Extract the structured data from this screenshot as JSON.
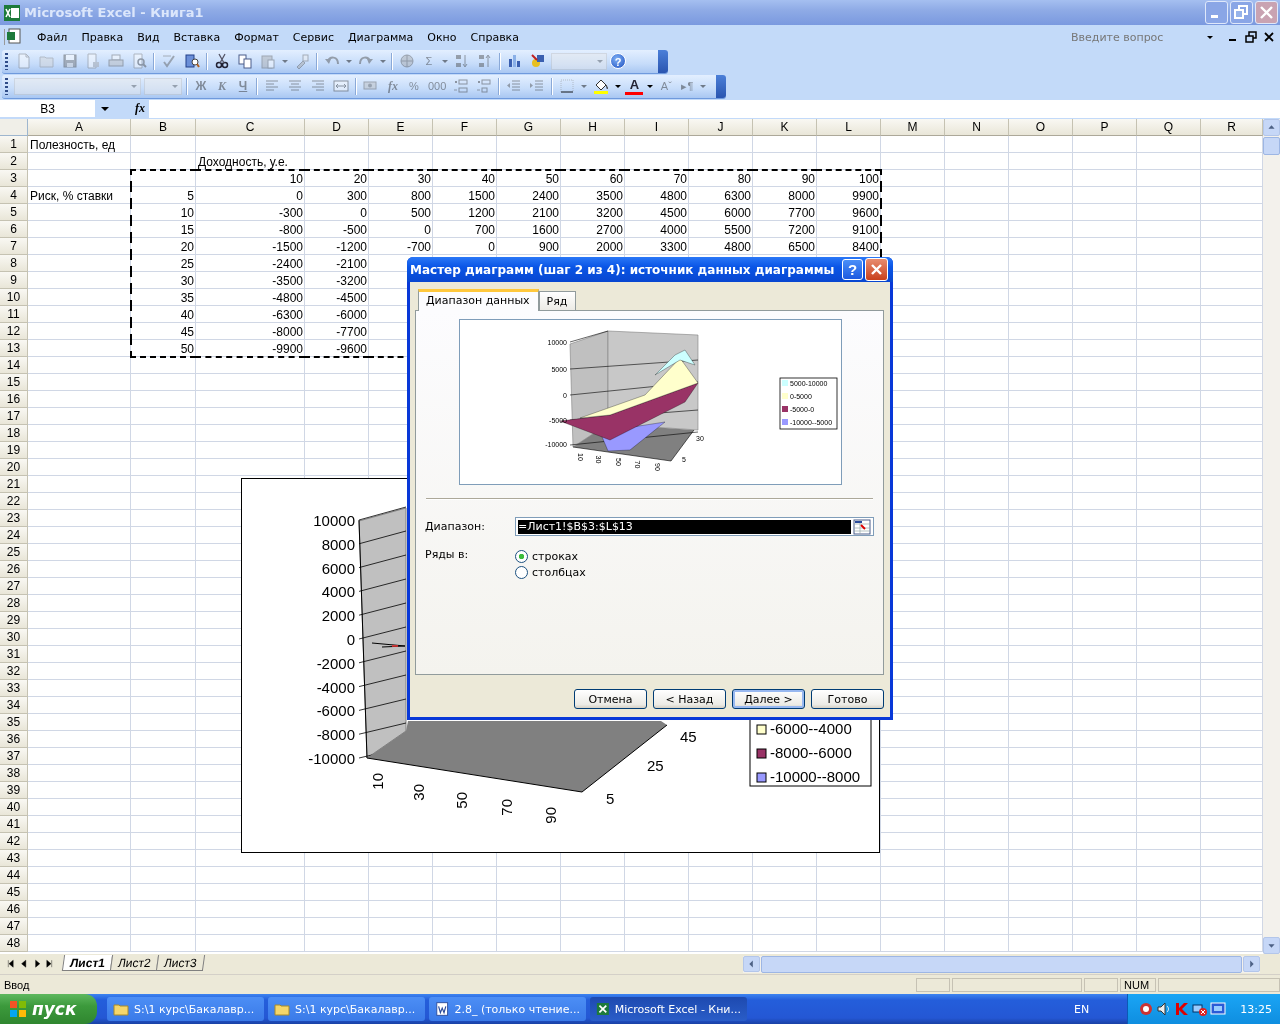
{
  "window": {
    "title": "Microsoft Excel - Книга1"
  },
  "menu": [
    "Файл",
    "Правка",
    "Вид",
    "Вставка",
    "Формат",
    "Сервис",
    "Диаграмма",
    "Окно",
    "Справка"
  ],
  "help_box": {
    "placeholder": "Введите вопрос"
  },
  "toolbar_standard": [
    {
      "kind": "new",
      "disabled": true
    },
    {
      "kind": "open",
      "disabled": true
    },
    {
      "kind": "save",
      "disabled": true
    },
    {
      "kind": "permission",
      "disabled": true
    },
    {
      "kind": "print",
      "disabled": true
    },
    {
      "kind": "preview",
      "disabled": true
    },
    {
      "kind": "sep",
      "disabled": false
    },
    {
      "kind": "spell",
      "disabled": true
    },
    {
      "kind": "research",
      "disabled": false
    },
    {
      "kind": "sep",
      "disabled": false
    },
    {
      "kind": "cut",
      "disabled": false
    },
    {
      "kind": "copy",
      "disabled": false
    },
    {
      "kind": "paste",
      "disabled": true
    },
    {
      "kind": "caret",
      "disabled": true
    },
    {
      "kind": "brush",
      "disabled": true
    },
    {
      "kind": "sep",
      "disabled": false
    },
    {
      "kind": "undo",
      "disabled": true
    },
    {
      "kind": "caret",
      "disabled": true
    },
    {
      "kind": "redo",
      "disabled": true
    },
    {
      "kind": "caret",
      "disabled": true
    },
    {
      "kind": "sep",
      "disabled": false
    },
    {
      "kind": "hyperlink",
      "disabled": true
    },
    {
      "kind": "text",
      "label": "Σ",
      "disabled": true
    },
    {
      "kind": "caret",
      "disabled": true
    },
    {
      "kind": "sortasc",
      "disabled": true
    },
    {
      "kind": "sortdesc",
      "disabled": true
    },
    {
      "kind": "sep",
      "disabled": false
    },
    {
      "kind": "chart",
      "disabled": false
    },
    {
      "kind": "drawing",
      "disabled": false
    },
    {
      "kind": "combo",
      "disabled": true
    },
    {
      "kind": "help",
      "label": "?",
      "disabled": false
    }
  ],
  "toolbar_formatting": [
    {
      "kind": "fontcombo",
      "disabled": true
    },
    {
      "kind": "sizecombo",
      "disabled": true
    },
    {
      "kind": "sep",
      "disabled": false
    },
    {
      "kind": "bold",
      "label": "Ж",
      "disabled": true
    },
    {
      "kind": "italic",
      "label": "К",
      "disabled": true
    },
    {
      "kind": "underline",
      "label": "Ч",
      "disabled": true
    },
    {
      "kind": "sep",
      "disabled": false
    },
    {
      "kind": "alignleft",
      "disabled": true
    },
    {
      "kind": "center",
      "disabled": true
    },
    {
      "kind": "alignright",
      "disabled": true
    },
    {
      "kind": "merge",
      "disabled": true
    },
    {
      "kind": "sep",
      "disabled": false
    },
    {
      "kind": "currency",
      "disabled": true
    },
    {
      "kind": "italic",
      "label": "fx",
      "disabled": true
    },
    {
      "kind": "text",
      "label": "%",
      "disabled": true
    },
    {
      "kind": "text",
      "label": "000",
      "disabled": true
    },
    {
      "kind": "incdec",
      "disabled": true
    },
    {
      "kind": "decdec",
      "disabled": true
    },
    {
      "kind": "sep",
      "disabled": false
    },
    {
      "kind": "outdent",
      "disabled": true
    },
    {
      "kind": "indent",
      "disabled": true
    },
    {
      "kind": "sep",
      "disabled": false
    },
    {
      "kind": "borders",
      "disabled": true
    },
    {
      "kind": "caret",
      "disabled": true
    },
    {
      "kind": "fill",
      "disabled": false
    },
    {
      "kind": "caret",
      "disabled": false
    },
    {
      "kind": "fontcolor",
      "label": "A",
      "disabled": false
    },
    {
      "kind": "caret",
      "disabled": false
    },
    {
      "kind": "text",
      "label": "Aˇ",
      "disabled": true
    },
    {
      "kind": "text",
      "label": "▸¶",
      "disabled": true
    },
    {
      "kind": "caret",
      "disabled": true
    }
  ],
  "name_box": {
    "value": "B3"
  },
  "formula_bar": {
    "fx": "fx"
  },
  "columns": [
    {
      "label": "A",
      "in_marquee": false
    },
    {
      "label": "B",
      "in_marquee": true
    },
    {
      "label": "C",
      "in_marquee": true
    },
    {
      "label": "D",
      "in_marquee": true
    },
    {
      "label": "E",
      "in_marquee": true
    },
    {
      "label": "F",
      "in_marquee": true
    },
    {
      "label": "G",
      "in_marquee": true
    },
    {
      "label": "H",
      "in_marquee": true
    },
    {
      "label": "I",
      "in_marquee": true
    },
    {
      "label": "J",
      "in_marquee": true
    },
    {
      "label": "K",
      "in_marquee": true
    },
    {
      "label": "L",
      "in_marquee": true
    },
    {
      "label": "M",
      "in_marquee": false
    },
    {
      "label": "N",
      "in_marquee": false
    },
    {
      "label": "O",
      "in_marquee": false
    },
    {
      "label": "P",
      "in_marquee": false
    },
    {
      "label": "Q",
      "in_marquee": false
    },
    {
      "label": "R",
      "in_marquee": false
    }
  ],
  "rows": [
    {
      "number": "1",
      "in_marquee": false,
      "cells": {
        "A": {
          "text": "Полезность, ед",
          "kind": "text"
        }
      }
    },
    {
      "number": "2",
      "in_marquee": false,
      "cells": {
        "C": {
          "text": "Доходность, у.е.",
          "kind": "text"
        }
      }
    },
    {
      "number": "3",
      "in_marquee": true,
      "cells": {
        "C": {
          "text": "10",
          "kind": "number"
        },
        "D": {
          "text": "20",
          "kind": "number"
        },
        "E": {
          "text": "30",
          "kind": "number"
        },
        "F": {
          "text": "40",
          "kind": "number"
        },
        "G": {
          "text": "50",
          "kind": "number"
        },
        "H": {
          "text": "60",
          "kind": "number"
        },
        "I": {
          "text": "70",
          "kind": "number"
        },
        "J": {
          "text": "80",
          "kind": "number"
        },
        "K": {
          "text": "90",
          "kind": "number"
        },
        "L": {
          "text": "100",
          "kind": "number"
        }
      }
    },
    {
      "number": "4",
      "in_marquee": true,
      "cells": {
        "A": {
          "text": "Риск, % ставки",
          "kind": "text"
        },
        "B": {
          "text": "5",
          "kind": "number"
        },
        "C": {
          "text": "0",
          "kind": "number"
        },
        "D": {
          "text": "300",
          "kind": "number"
        },
        "E": {
          "text": "800",
          "kind": "number"
        },
        "F": {
          "text": "1500",
          "kind": "number"
        },
        "G": {
          "text": "2400",
          "kind": "number"
        },
        "H": {
          "text": "3500",
          "kind": "number"
        },
        "I": {
          "text": "4800",
          "kind": "number"
        },
        "J": {
          "text": "6300",
          "kind": "number"
        },
        "K": {
          "text": "8000",
          "kind": "number"
        },
        "L": {
          "text": "9900",
          "kind": "number"
        }
      }
    },
    {
      "number": "5",
      "in_marquee": true,
      "cells": {
        "B": {
          "text": "10",
          "kind": "number"
        },
        "C": {
          "text": "-300",
          "kind": "number"
        },
        "D": {
          "text": "0",
          "kind": "number"
        },
        "E": {
          "text": "500",
          "kind": "number"
        },
        "F": {
          "text": "1200",
          "kind": "number"
        },
        "G": {
          "text": "2100",
          "kind": "number"
        },
        "H": {
          "text": "3200",
          "kind": "number"
        },
        "I": {
          "text": "4500",
          "kind": "number"
        },
        "J": {
          "text": "6000",
          "kind": "number"
        },
        "K": {
          "text": "7700",
          "kind": "number"
        },
        "L": {
          "text": "9600",
          "kind": "number"
        }
      }
    },
    {
      "number": "6",
      "in_marquee": true,
      "cells": {
        "B": {
          "text": "15",
          "kind": "number"
        },
        "C": {
          "text": "-800",
          "kind": "number"
        },
        "D": {
          "text": "-500",
          "kind": "number"
        },
        "E": {
          "text": "0",
          "kind": "number"
        },
        "F": {
          "text": "700",
          "kind": "number"
        },
        "G": {
          "text": "1600",
          "kind": "number"
        },
        "H": {
          "text": "2700",
          "kind": "number"
        },
        "I": {
          "text": "4000",
          "kind": "number"
        },
        "J": {
          "text": "5500",
          "kind": "number"
        },
        "K": {
          "text": "7200",
          "kind": "number"
        },
        "L": {
          "text": "9100",
          "kind": "number"
        }
      }
    },
    {
      "number": "7",
      "in_marquee": true,
      "cells": {
        "B": {
          "text": "20",
          "kind": "number"
        },
        "C": {
          "text": "-1500",
          "kind": "number"
        },
        "D": {
          "text": "-1200",
          "kind": "number"
        },
        "E": {
          "text": "-700",
          "kind": "number"
        },
        "F": {
          "text": "0",
          "kind": "number"
        },
        "G": {
          "text": "900",
          "kind": "number"
        },
        "H": {
          "text": "2000",
          "kind": "number"
        },
        "I": {
          "text": "3300",
          "kind": "number"
        },
        "J": {
          "text": "4800",
          "kind": "number"
        },
        "K": {
          "text": "6500",
          "kind": "number"
        },
        "L": {
          "text": "8400",
          "kind": "number"
        }
      }
    },
    {
      "number": "8",
      "in_marquee": true,
      "cells": {
        "B": {
          "text": "25",
          "kind": "number"
        },
        "C": {
          "text": "-2400",
          "kind": "number"
        },
        "D": {
          "text": "-2100",
          "kind": "number"
        }
      }
    },
    {
      "number": "9",
      "in_marquee": true,
      "cells": {
        "B": {
          "text": "30",
          "kind": "number"
        },
        "C": {
          "text": "-3500",
          "kind": "number"
        },
        "D": {
          "text": "-3200",
          "kind": "number"
        }
      }
    },
    {
      "number": "10",
      "in_marquee": true,
      "cells": {
        "B": {
          "text": "35",
          "kind": "number"
        },
        "C": {
          "text": "-4800",
          "kind": "number"
        },
        "D": {
          "text": "-4500",
          "kind": "number"
        }
      }
    },
    {
      "number": "11",
      "in_marquee": true,
      "cells": {
        "B": {
          "text": "40",
          "kind": "number"
        },
        "C": {
          "text": "-6300",
          "kind": "number"
        },
        "D": {
          "text": "-6000",
          "kind": "number"
        }
      }
    },
    {
      "number": "12",
      "in_marquee": true,
      "cells": {
        "B": {
          "text": "45",
          "kind": "number"
        },
        "C": {
          "text": "-8000",
          "kind": "number"
        },
        "D": {
          "text": "-7700",
          "kind": "number"
        }
      }
    },
    {
      "number": "13",
      "in_marquee": true,
      "cells": {
        "B": {
          "text": "50",
          "kind": "number"
        },
        "C": {
          "text": "-9900",
          "kind": "number"
        },
        "D": {
          "text": "-9600",
          "kind": "number"
        }
      }
    },
    {
      "number": "14",
      "in_marquee": false
    },
    {
      "number": "15",
      "in_marquee": false
    },
    {
      "number": "16",
      "in_marquee": false
    },
    {
      "number": "17",
      "in_marquee": false
    },
    {
      "number": "18",
      "in_marquee": false
    },
    {
      "number": "19",
      "in_marquee": false
    },
    {
      "number": "20",
      "in_marquee": false
    },
    {
      "number": "21",
      "in_marquee": false
    },
    {
      "number": "22",
      "in_marquee": false
    },
    {
      "number": "23",
      "in_marquee": false
    },
    {
      "number": "24",
      "in_marquee": false
    },
    {
      "number": "25",
      "in_marquee": false
    },
    {
      "number": "26",
      "in_marquee": false
    },
    {
      "number": "27",
      "in_marquee": false
    },
    {
      "number": "28",
      "in_marquee": false
    },
    {
      "number": "29",
      "in_marquee": false
    },
    {
      "number": "30",
      "in_marquee": false
    },
    {
      "number": "31",
      "in_marquee": false
    },
    {
      "number": "32",
      "in_marquee": false
    },
    {
      "number": "33",
      "in_marquee": false
    },
    {
      "number": "34",
      "in_marquee": false
    },
    {
      "number": "35",
      "in_marquee": false
    },
    {
      "number": "36",
      "in_marquee": false
    },
    {
      "number": "37",
      "in_marquee": false
    },
    {
      "number": "38",
      "in_marquee": false
    },
    {
      "number": "39",
      "in_marquee": false
    },
    {
      "number": "40",
      "in_marquee": false
    },
    {
      "number": "41",
      "in_marquee": false
    },
    {
      "number": "42",
      "in_marquee": false
    },
    {
      "number": "43",
      "in_marquee": false
    },
    {
      "number": "44",
      "in_marquee": false
    },
    {
      "number": "45",
      "in_marquee": false
    },
    {
      "number": "46",
      "in_marquee": false
    },
    {
      "number": "47",
      "in_marquee": false
    },
    {
      "number": "48",
      "in_marquee": false
    }
  ],
  "embedded_chart": {
    "zticks": [
      "10000",
      "8000",
      "6000",
      "4000",
      "2000",
      "0",
      "-2000",
      "-4000",
      "-6000",
      "-8000",
      "-10000"
    ],
    "xticks": [
      "10",
      "30",
      "50",
      "70",
      "90"
    ],
    "yticks": [
      "5",
      "25",
      "45"
    ],
    "legend": [
      {
        "label": "-6000--4000",
        "color": "#ffffcc"
      },
      {
        "label": "-8000--6000",
        "color": "#993366"
      },
      {
        "label": "-10000--8000",
        "color": "#9999ff"
      }
    ]
  },
  "dialog": {
    "title": "Мастер диаграмм (шаг 2 из 4): источник данных диаграммы",
    "help": "?",
    "tabs": [
      {
        "label": "Диапазон данных",
        "selected": true
      },
      {
        "label": "Ряд",
        "selected": false
      }
    ],
    "preview": {
      "zticks": [
        "10000",
        "5000",
        "0",
        "-5000",
        "-10000"
      ],
      "xticks": [
        "10",
        "30",
        "50",
        "70",
        "90"
      ],
      "yticks": [
        "30",
        "5"
      ],
      "legend": [
        {
          "label": "5000-10000",
          "color": "#ccffff"
        },
        {
          "label": "0-5000",
          "color": "#ffffcc"
        },
        {
          "label": "-5000-0",
          "color": "#993366"
        },
        {
          "label": "-10000--5000",
          "color": "#9999ff"
        }
      ]
    },
    "range_label": "Диапазон:",
    "range_value": "=Лист1!$B$3:$L$13",
    "series_label": "Ряды в:",
    "series_options": [
      {
        "label": "строках",
        "selected": true
      },
      {
        "label": "столбцах",
        "selected": false
      }
    ],
    "buttons": [
      {
        "label": "Отмена",
        "default": false
      },
      {
        "label": "< Назад",
        "default": false
      },
      {
        "label": "Далее >",
        "default": true
      },
      {
        "label": "Готово",
        "default": false
      }
    ]
  },
  "sheet_tabs": [
    {
      "label": "Лист1",
      "selected": true
    },
    {
      "label": "Лист2",
      "selected": false
    },
    {
      "label": "Лист3",
      "selected": false
    }
  ],
  "status_bar": {
    "mode": "Ввод",
    "num": "NUM"
  },
  "taskbar": {
    "start": "пуск",
    "tasks": [
      {
        "label": "S:\\1 курс\\Бакалавр...",
        "kind": "folder",
        "selected": false
      },
      {
        "label": "S:\\1 курс\\Бакалавр...",
        "kind": "folder",
        "selected": false
      },
      {
        "label": "2.8_ (только чтение...",
        "kind": "word",
        "selected": false
      },
      {
        "label": "Microsoft Excel - Кни...",
        "kind": "excel",
        "selected": true
      }
    ],
    "language": "EN",
    "clock": "13:25"
  }
}
